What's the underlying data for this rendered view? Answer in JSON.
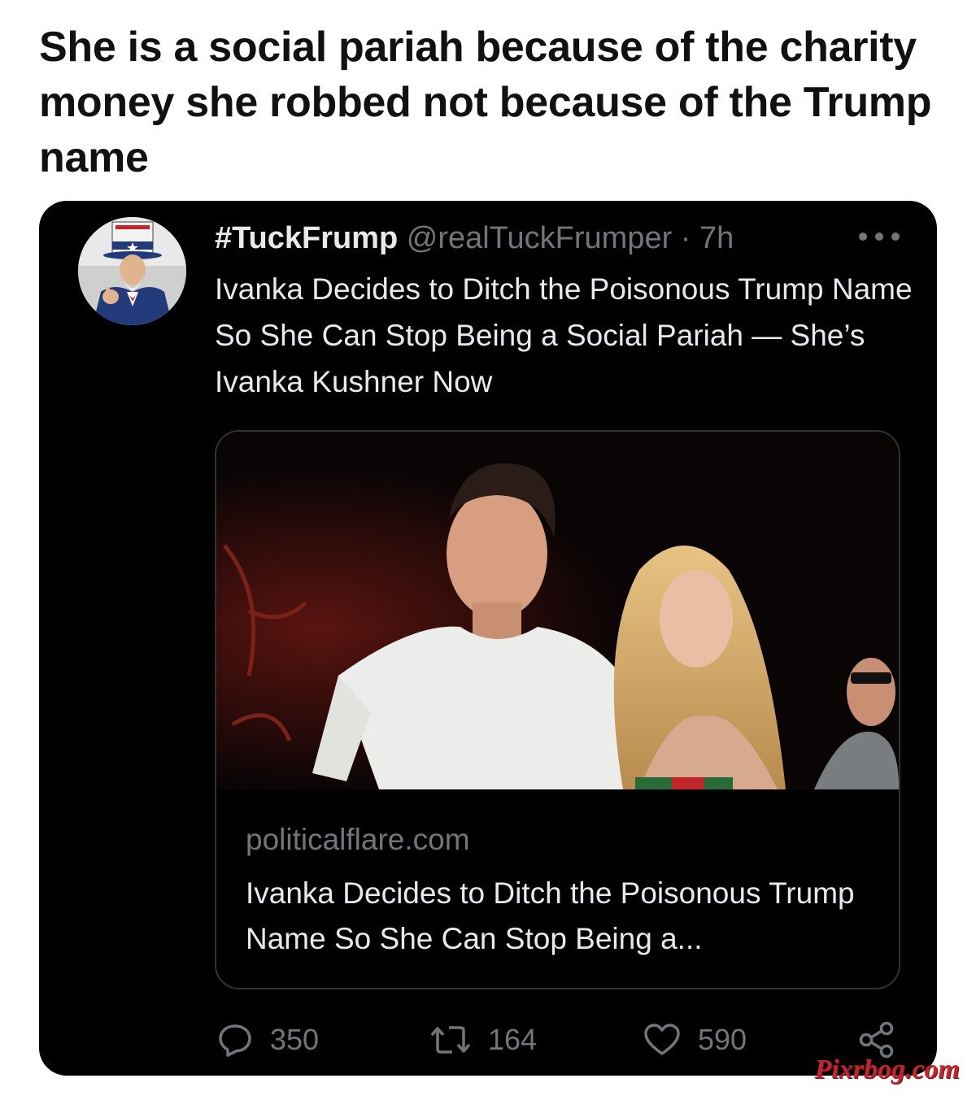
{
  "caption": "She is a social pariah because of the charity money she robbed not because of the Trump name",
  "tweet": {
    "avatar_icon": "uncle-sam-avatar-icon",
    "display_name": "#TuckFrump",
    "handle": "@realTuckFrumper",
    "separator": "·",
    "time": "7h",
    "more_icon": "more-options-icon",
    "text": "Ivanka Decides to Ditch the Poisonous Trump Name So She Can Stop Being a Social Pariah — She’s Ivanka Kushner Now",
    "card": {
      "image_icon": "article-photo-icon",
      "domain": "politicalflare.com",
      "title": "Ivanka Decides to Ditch the Poisonous Trump Name So She Can Stop Being a..."
    },
    "actions": {
      "reply_count": "350",
      "retweet_count": "164",
      "like_count": "590",
      "reply_icon": "reply-bubble-icon",
      "retweet_icon": "retweet-icon",
      "like_icon": "heart-icon",
      "share_icon": "share-icon"
    }
  },
  "watermark": "Pixrbog.com",
  "colors": {
    "card_background": "#000000",
    "primary_text": "#e7e9ea",
    "secondary_text": "#71767b",
    "border": "#2f3336",
    "watermark": "#c0262b"
  }
}
